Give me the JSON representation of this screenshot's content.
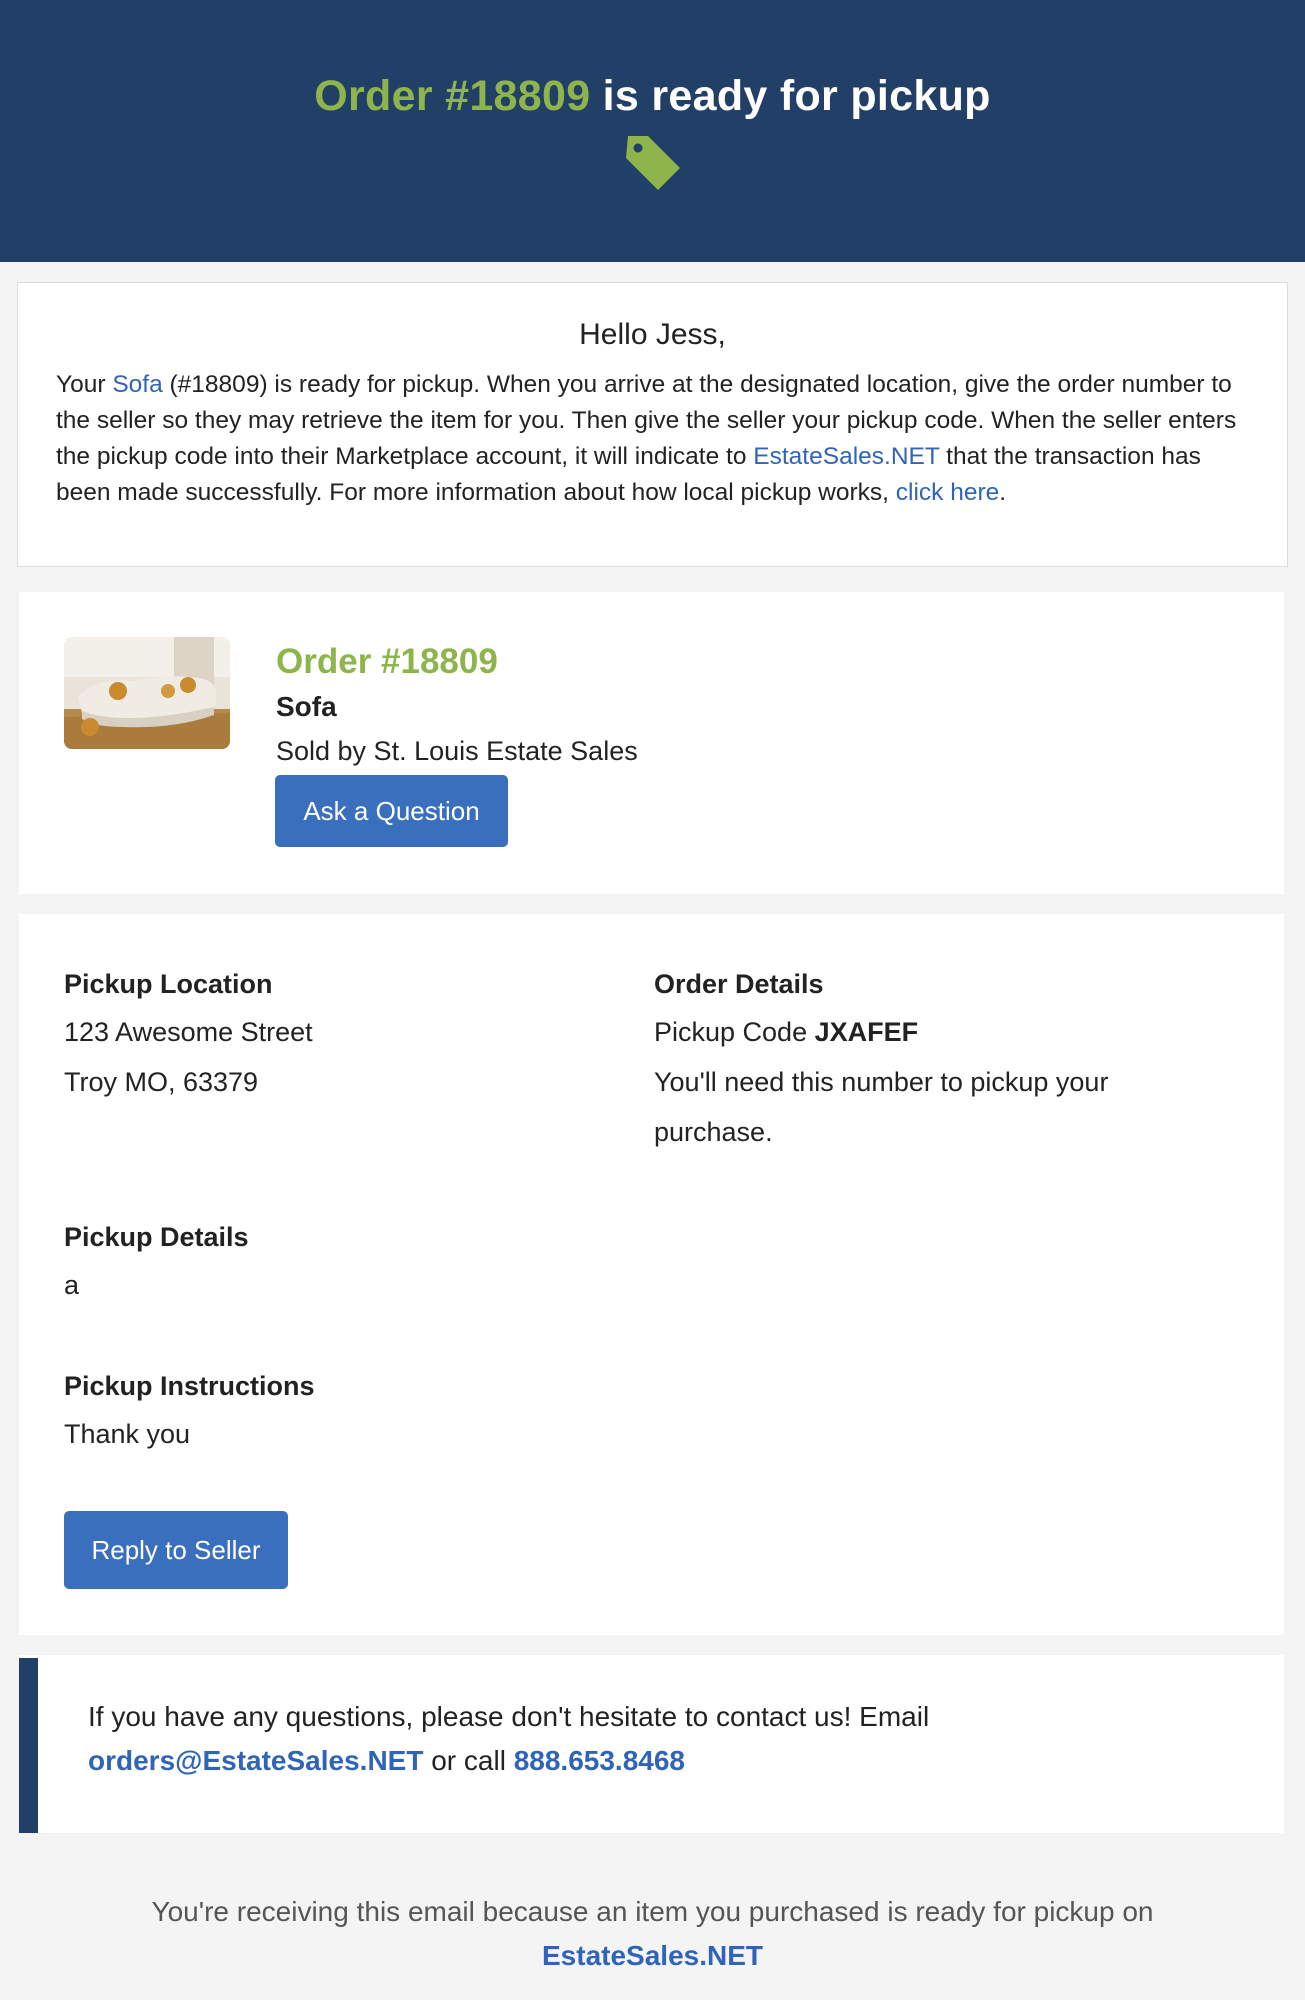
{
  "header": {
    "title_accent": "Order #18809",
    "title_rest": " is ready for pickup",
    "icon": "tag-icon",
    "colors": {
      "background": "#223f68",
      "accent": "#8db54b"
    }
  },
  "greeting": {
    "title": "Hello Jess,",
    "body_p1": "Your ",
    "item_link": "Sofa",
    "body_p2": " (#18809) is ready for pickup. When you arrive at the designated location, give the order number to the seller so they may retrieve the item for you. Then give the seller your pickup code. When the seller enters the pickup code into their Marketplace account, it will indicate to ",
    "site_link": "EstateSales.NET",
    "body_p3": " that the transaction has been made successfully. For more information about how local pickup works, ",
    "help_link": "click here",
    "body_p4": "."
  },
  "order": {
    "number": "Order #18809",
    "item_name": "Sofa",
    "sold_by": "Sold by St. Louis Estate Sales",
    "ask_button": "Ask a Question"
  },
  "pickup": {
    "location_label": "Pickup Location",
    "address_line1": "123 Awesome Street",
    "address_line2": "Troy MO, 63379",
    "details_label": "Order Details",
    "code_prefix": "Pickup Code ",
    "code": "JXAFEF",
    "code_note_line1": "You'll need this number to pickup your",
    "code_note_line2": "purchase.",
    "pickup_details_label": "Pickup Details",
    "pickup_details_value": "a",
    "instructions_label": "Pickup Instructions",
    "instructions_value": "Thank you",
    "reply_button": "Reply to Seller"
  },
  "contact": {
    "text1": "If you have any questions, please don't hesitate to contact us! Email",
    "email": "orders@EstateSales.NET",
    "text2": " or call ",
    "phone": "888.653.8468"
  },
  "footer": {
    "text": "You're receiving this email because an item you purchased is ready for pickup on",
    "link": "EstateSales.NET"
  }
}
